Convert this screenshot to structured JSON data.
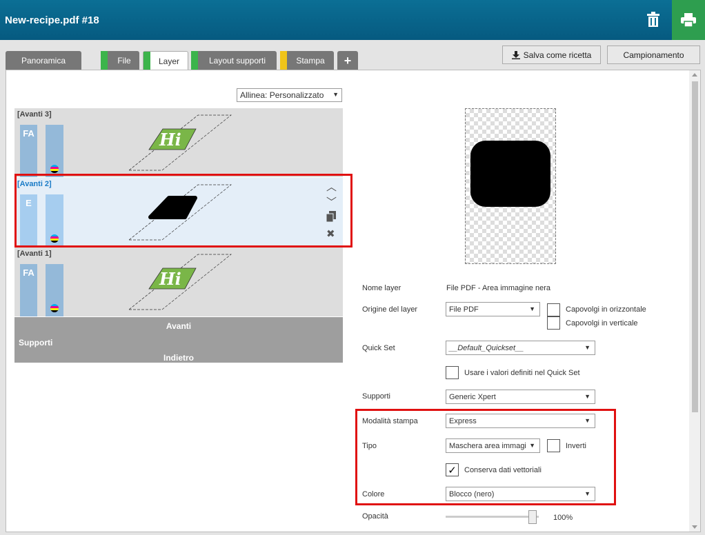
{
  "header": {
    "title": "New-recipe.pdf #18",
    "icons": [
      "trash-icon",
      "print-icon"
    ]
  },
  "tabs": [
    {
      "label": "Panoramica",
      "strip_color": ""
    },
    {
      "label": "File",
      "strip_color": "#3cb44b"
    },
    {
      "label": "Layer",
      "strip_color": "#3cb44b",
      "active": true
    },
    {
      "label": "Layout supporti",
      "strip_color": "#3cb44b"
    },
    {
      "label": "Stampa",
      "strip_color": "#f0c419"
    }
  ],
  "toolbar": {
    "save_recipe": "Salva come ricetta",
    "sampling": "Campionamento"
  },
  "align": {
    "value": "Allinea: Personalizzato"
  },
  "layers": [
    {
      "name": "[Avanti 3]",
      "badge": "FA"
    },
    {
      "name": "[Avanti 2]",
      "badge": "E"
    },
    {
      "name": "[Avanti 1]",
      "badge": "FA"
    }
  ],
  "supports": {
    "title": "Supporti",
    "front": "Avanti",
    "back": "Indietro"
  },
  "props": {
    "layer_name_label": "Nome layer",
    "layer_name_value": "File PDF - Area immagine nera",
    "origin_label": "Origine del layer",
    "origin_value": "File PDF",
    "flip_h": "Capovolgi in orizzontale",
    "flip_v": "Capovolgi in verticale",
    "quickset_label": "Quick Set",
    "quickset_value": "__Default_Quickset__",
    "use_quickset": "Usare i valori definiti nel Quick Set",
    "media_label": "Supporti",
    "media_value": "Generic Xpert",
    "print_mode_label": "Modalità stampa",
    "print_mode_value": "Express",
    "type_label": "Tipo",
    "type_value": "Maschera area immagi",
    "invert": "Inverti",
    "keep_vector": "Conserva dati vettoriali",
    "keep_vector_checked": true,
    "color_label": "Colore",
    "color_value": "Blocco (nero)",
    "opacity_label": "Opacità",
    "opacity_value": "100%",
    "opacity_level": 1.0
  },
  "colors": {
    "header": "#0b6f95",
    "print": "#2e9e4f",
    "highlight": "#e01010",
    "selected_name": "#1a7bc6"
  }
}
